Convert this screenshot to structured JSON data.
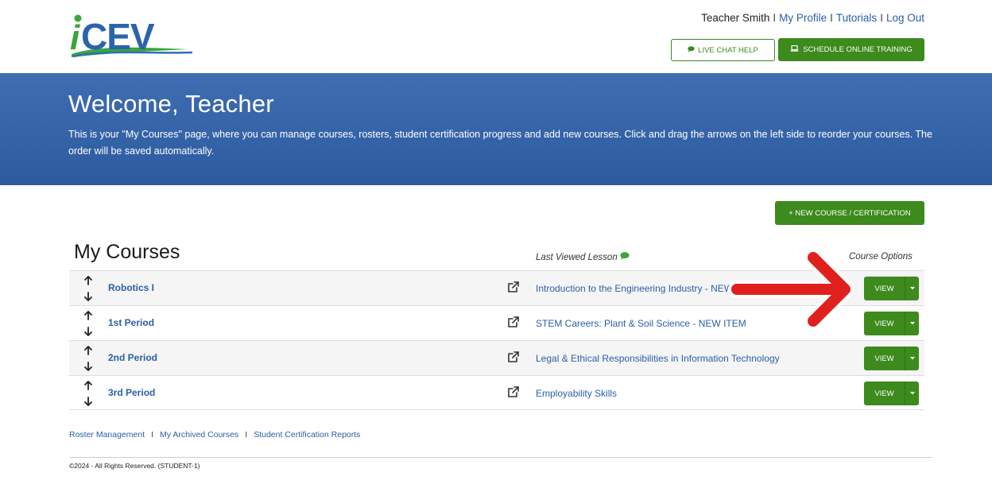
{
  "header": {
    "logo_text": "iCEV",
    "user_name": "Teacher Smith",
    "links": [
      "My Profile",
      "Tutorials",
      "Log Out"
    ],
    "separator": "I",
    "live_chat_label": "LIVE CHAT HELP",
    "schedule_label": "SCHEDULE ONLINE TRAINING"
  },
  "banner": {
    "title": "Welcome, Teacher",
    "description": "This is your \"My Courses\" page, where you can manage courses, rosters, student certification progress and add new courses. Click and drag the arrows on the left side to reorder your courses. The order will be saved automatically."
  },
  "new_course_label": "+ NEW COURSE / CERTIFICATION",
  "courses": {
    "title": "My Courses",
    "col_last_viewed": "Last Viewed Lesson",
    "col_options": "Course Options",
    "view_label": "VIEW",
    "rows": [
      {
        "name": "Robotics I",
        "lesson": "Introduction to the Engineering Industry - NEW ITEM"
      },
      {
        "name": "1st Period",
        "lesson": "STEM Careers: Plant & Soil Science - NEW ITEM"
      },
      {
        "name": "2nd Period",
        "lesson": "Legal & Ethical Responsibilities in Information Technology"
      },
      {
        "name": "3rd Period",
        "lesson": "Employability Skills"
      }
    ]
  },
  "footer": {
    "links": [
      "Roster Management",
      "My Archived Courses",
      "Student Certification Reports"
    ],
    "separator": "I",
    "copyright": "©2024 - All Rights Reserved. (STUDENT-1)"
  },
  "colors": {
    "brand_green": "#3d8a1d",
    "banner_blue": "#3563a8",
    "link_blue": "#2a5ea8",
    "annotation_red": "#e0201c"
  }
}
